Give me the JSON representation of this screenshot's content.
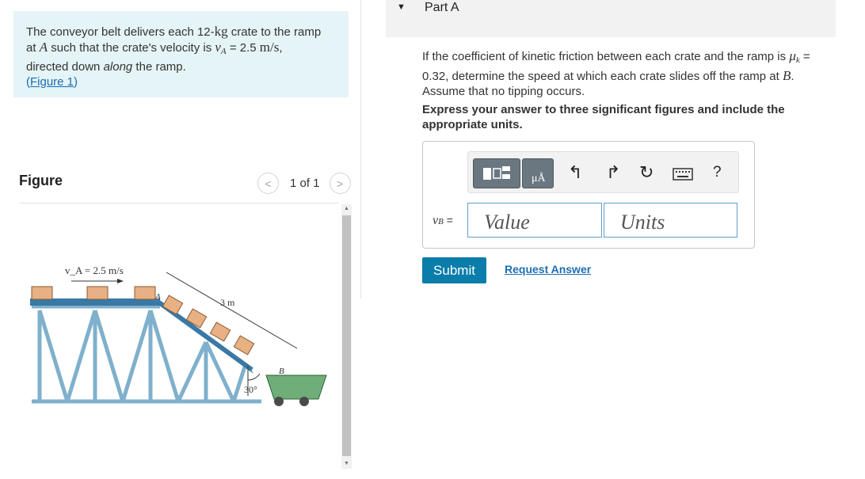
{
  "problem": {
    "p1": "The conveyor belt delivers each 12-",
    "unit_kg": "kg",
    "p2": " crate to the ramp",
    "p3": "at ",
    "sym_A": "A",
    "p4": " such that the crate's velocity is ",
    "sym_vA": "v",
    "sub_A": "A",
    "p5": " = 2.5 ",
    "unit_ms": "m/s",
    "p6": ",",
    "p7": "directed down ",
    "along": "along",
    "p8": " the ramp.",
    "link_open": "(",
    "link": "Figure 1",
    "link_close": ")"
  },
  "figure": {
    "heading": "Figure",
    "pager_count": "1 of 1",
    "prev_glyph": "<",
    "next_glyph": ">",
    "image_labels": {
      "velocity": "v_A = 2.5 m/s",
      "length": "3 m",
      "point_a": "A",
      "point_b": "B",
      "angle": "30°"
    }
  },
  "part": {
    "toggle_glyph": "▼",
    "title": "Part A"
  },
  "question": {
    "q1": "If the coefficient of kinetic friction between each crate and the ramp is ",
    "mu": "μ",
    "mu_sub": "k",
    "q2": " =",
    "q3": "0.32, determine the speed at which each crate slides off the ramp at ",
    "sym_B": "B",
    "q4": ".",
    "q5": "Assume that no tipping occurs.",
    "instruction": "Express your answer to three significant figures and include the appropriate units."
  },
  "answer": {
    "label_sym": "v",
    "label_sub": "B",
    "label_eq": " =",
    "value_placeholder": "Value",
    "units_placeholder": "Units",
    "toolbar": [
      "templates-icon",
      "units-icon",
      "undo-icon",
      "redo-icon",
      "reset-icon",
      "keyboard-icon",
      "help-icon"
    ],
    "help_glyph": "?"
  },
  "actions": {
    "submit": "Submit",
    "request": "Request Answer"
  },
  "colors": {
    "problem_bg": "#e5f4f6",
    "link": "#1a6cb8",
    "submit_bg": "#0b7daa",
    "field_border": "#5f9fc8",
    "toolbar_btn": "#6a7780"
  }
}
